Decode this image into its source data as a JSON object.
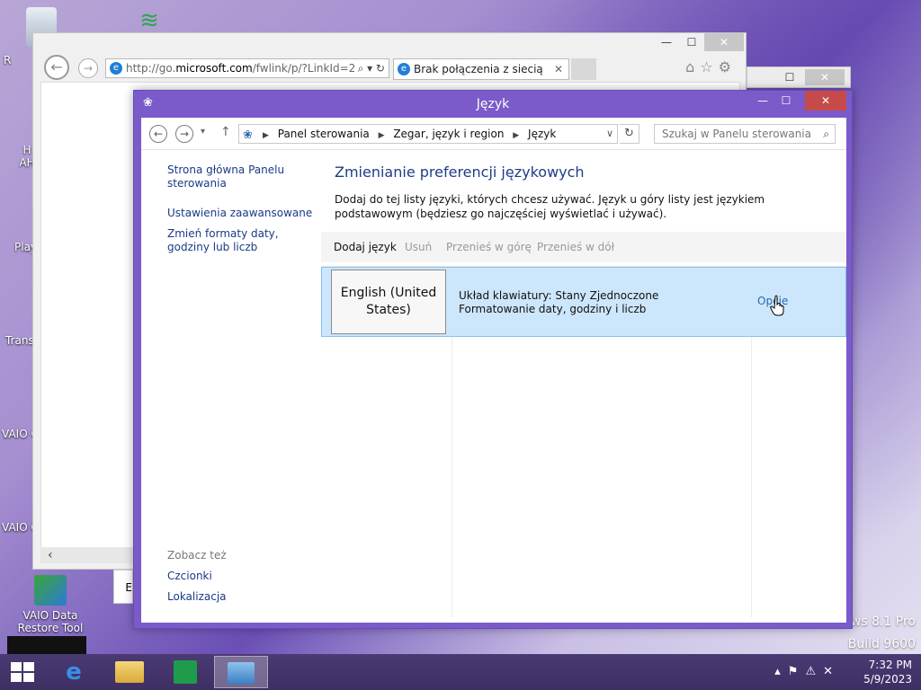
{
  "desktop": {
    "icons": [
      {
        "label": "R",
        "name": "recycle-bin"
      },
      {
        "label": "H\nAH",
        "name": "desktop-icon-h"
      },
      {
        "label": "Play",
        "name": "desktop-icon-play"
      },
      {
        "label": "Trans",
        "name": "desktop-icon-trans"
      },
      {
        "label": "VAIO C",
        "name": "desktop-icon-vaio-c1"
      },
      {
        "label": "VAIO C",
        "name": "desktop-icon-vaio-c2"
      }
    ],
    "vaio_restore_label": "VAIO Data Restore Tool",
    "watermark_line1": "ows 8.1 Pro",
    "watermark_line2": "Build 9600"
  },
  "ie": {
    "address": "http://go.microsoft.com/fwlink/p/?LinkId=2",
    "address_prefix": "http://go.",
    "address_domain": "microsoft.com",
    "address_suffix": "/fwlink/p/?LinkId=2",
    "tab_title": "Brak połączenia z siecią"
  },
  "window": {
    "title": "Język",
    "breadcrumb": [
      "Panel sterowania",
      "Zegar, język i region",
      "Język"
    ],
    "search_placeholder": "Szukaj w Panelu sterowania"
  },
  "sidebar": {
    "home": "Strona główna Panelu sterowania",
    "advanced": "Ustawienia zaawansowane",
    "formats": "Zmień formaty daty, godziny lub liczb",
    "see_also": "Zobacz też",
    "fonts": "Czcionki",
    "location": "Lokalizacja"
  },
  "main": {
    "title": "Zmienianie preferencji językowych",
    "description": "Dodaj do tej listy języki, których chcesz używać. Język u góry listy jest językiem podstawowym (będziesz go najczęściej wyświetlać i używać).",
    "toolbar": {
      "add": "Dodaj język",
      "remove": "Usuń",
      "move_up": "Przenieś w górę",
      "move_down": "Przenieś w dół"
    },
    "languages": [
      {
        "name": "English (United States)",
        "keyboard": "Układ klawiatury: Stany Zjednoczone",
        "formatting": "Formatowanie daty, godziny i liczb",
        "options": "Opcje"
      }
    ]
  },
  "taskbar": {
    "time": "7:32 PM",
    "date": "5/9/2023"
  },
  "colors": {
    "accent": "#7a5bc9",
    "close_red": "#c74a4a",
    "selection": "#cce6fb",
    "link": "#1a3a86"
  }
}
